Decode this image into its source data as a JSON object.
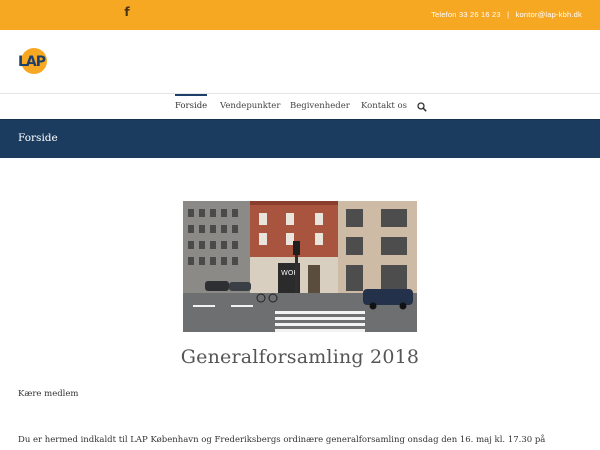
{
  "topbar": {
    "phone": "Telefon 33 26 16 23",
    "separator": "|",
    "email": "kontor@lap-kbh.dk",
    "social_icon": "facebook-icon",
    "background": "#f7a823"
  },
  "header": {
    "logo_text": "LAP"
  },
  "nav": {
    "items": [
      {
        "label": "Forside",
        "active": true
      },
      {
        "label": "Vendepunkter",
        "active": false
      },
      {
        "label": "Begivenheder",
        "active": false
      },
      {
        "label": "Kontakt os",
        "active": false
      }
    ],
    "search_icon": "search-icon"
  },
  "banner": {
    "title": "Forside",
    "background": "#1b3c5f"
  },
  "post": {
    "image_caption_sign": "WOK",
    "title": "Generalforsamling 2018",
    "greeting": "Kære medlem",
    "body": "Du er hermed indkaldt til LAP København og Frederiksbergs ordinære generalforsamling onsdag den 16. maj kl. 17.30 på"
  }
}
